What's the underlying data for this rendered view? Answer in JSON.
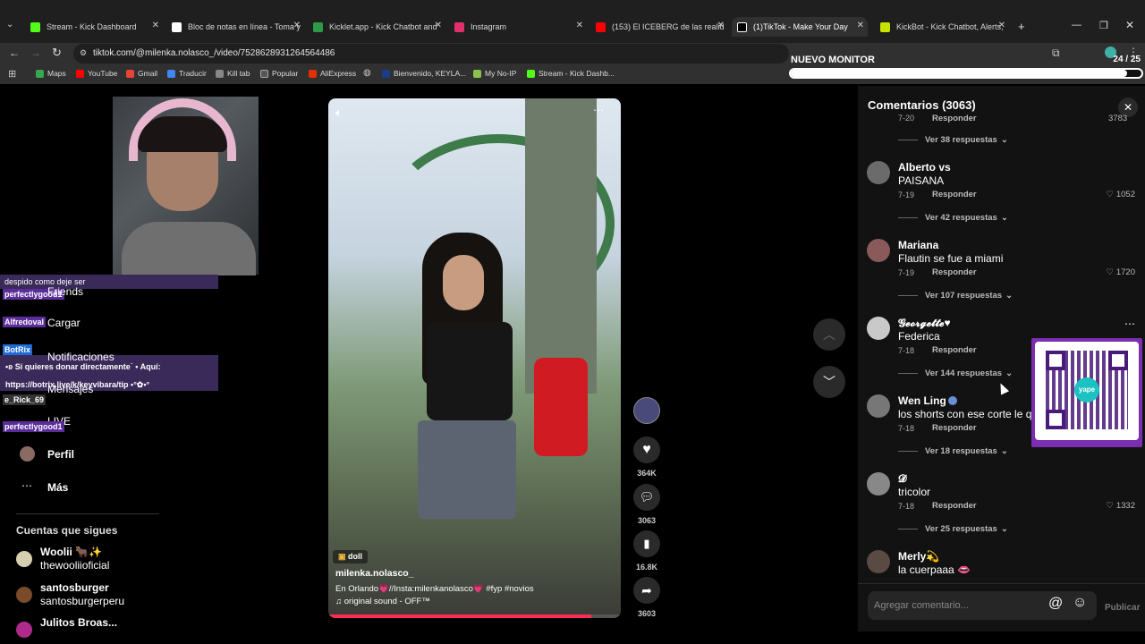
{
  "tabs": [
    {
      "label": "Stream - Kick Dashboard",
      "color": "#53fc18"
    },
    {
      "label": "Bloc de notas en línea - Toma y",
      "color": "#ffffff"
    },
    {
      "label": "Kicklet.app - Kick Chatbot and",
      "color": "#2d9a4a"
    },
    {
      "label": "Instagram",
      "color": "#e1306c"
    },
    {
      "label": "(153) El ICEBERG de las realida",
      "color": "#ff0000"
    },
    {
      "label": "(1)TikTok - Make Your Day",
      "color": "#000000"
    },
    {
      "label": "KickBot - Kick Chatbot, Alerts,",
      "color": "#c9e300"
    }
  ],
  "url": "tiktok.com/@milenka.nolasco_/video/7528628931264564486",
  "bookmarks": [
    "Maps",
    "YouTube",
    "Gmail",
    "Traducir",
    "Kill tab",
    "Popular",
    "AliExpress",
    "Bienvenido, KEYLA...",
    "My No-IP",
    "Stream - Kick Dashb..."
  ],
  "monitor": {
    "label": "NUEVO MONITOR",
    "count": "24 / 25",
    "progress": 0.96
  },
  "chat": {
    "line1": "despido como deje ser",
    "user1": "perfectlygood1",
    "user2": "Alfredoval",
    "bot": "BotRix",
    "bot_msg1": "•ʚ Si quieres donar directamente˙ • Aquí:",
    "bot_msg2": "https://botrix.live/k/keyvibara/tip •°✿•°",
    "user3": "e_Rick_69",
    "user4": "perfectlygood1"
  },
  "sidebar": {
    "items": [
      "Friends",
      "Cargar",
      "Notificaciones",
      "Mensajes",
      "LIVE",
      "Perfil",
      "Más"
    ],
    "following_title": "Cuentas que sigues",
    "following": [
      {
        "name": "Woolii 🐂✨",
        "handle": "thewooliioficial"
      },
      {
        "name": "santosburger",
        "handle": "santosburgerperu"
      },
      {
        "name": "Julitos Broas...",
        "handle": ""
      }
    ]
  },
  "video": {
    "sticker": "doll",
    "author": "milenka.nolasco_",
    "caption": "En Orlando💗//Insta:milenkanolasco💗 #fyp  #novios",
    "sound": "♫ original sound - OFF™",
    "likes": "364K",
    "comments": "3063",
    "saves": "16.8K",
    "shares": "3603"
  },
  "comments_panel": {
    "title": "Comentarios (3063)",
    "top_partial": {
      "date": "7-20",
      "reply": "Responder",
      "likes": "3783",
      "more": "Ver 38 respuestas"
    },
    "comments": [
      {
        "name": "Alberto vs",
        "text": "PAISANA",
        "date": "7-19",
        "reply": "Responder",
        "likes": "1052",
        "more": "Ver 42 respuestas",
        "avatar": "#6b6b6b"
      },
      {
        "name": "Mariana",
        "text": "Flautin se fue a miami",
        "date": "7-19",
        "reply": "Responder",
        "likes": "1720",
        "more": "Ver 107 respuestas",
        "avatar": "#8a5a5a"
      },
      {
        "name": "𝓖𝓮𝓸𝓻𝓰𝓮𝓽𝓽𝓮♥",
        "text": "Federica",
        "date": "7-18",
        "reply": "Responder",
        "likes": "",
        "more": "Ver 144 respuestas",
        "avatar": "#c9c9c9"
      },
      {
        "name": "Wen Ling",
        "text": "los shorts con ese corte le q",
        "date": "7-18",
        "reply": "Responder",
        "likes": "",
        "more": "Ver 18 respuestas",
        "avatar": "#777777"
      },
      {
        "name": "𝓓",
        "text": "tricolor",
        "date": "7-18",
        "reply": "Responder",
        "likes": "1332",
        "more": "Ver 25 respuestas",
        "avatar": "#888888"
      },
      {
        "name": "Merly💫",
        "text": "la cuerpaaa 👄",
        "date": "",
        "reply": "",
        "likes": "",
        "more": "",
        "avatar": "#5a4a44"
      }
    ],
    "input_placeholder": "Agregar comentario...",
    "publish": "Publicar"
  },
  "qr": {
    "caption": "yape"
  }
}
